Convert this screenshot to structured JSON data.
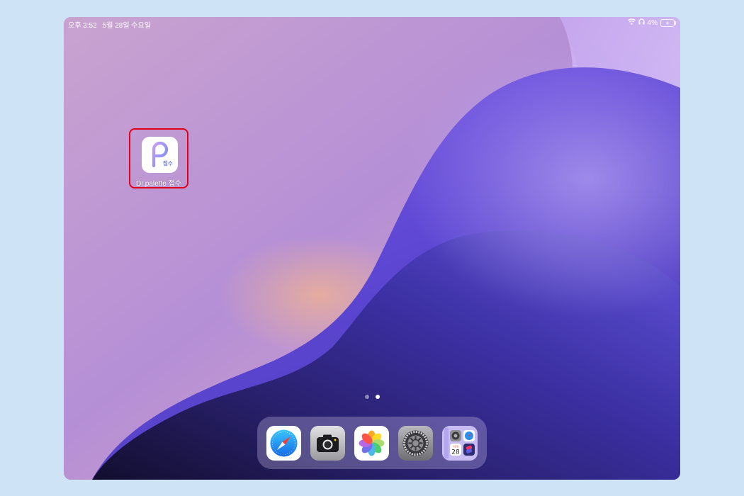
{
  "status_bar": {
    "time": "오후 3:52",
    "date": "5월 28일 수요일",
    "battery_percent": "4%"
  },
  "home_screen": {
    "apps": [
      {
        "label": "Dr.palette 접수",
        "icon_text": "접수",
        "icon": "dr-palette-icon",
        "highlighted": true
      }
    ],
    "page_count": 2,
    "active_page": 2
  },
  "dock": {
    "apps": [
      {
        "icon": "safari-icon"
      },
      {
        "icon": "camera-icon"
      },
      {
        "icon": "photos-icon"
      },
      {
        "icon": "settings-icon"
      },
      {
        "icon": "app-library-icon",
        "calendar_day": "28",
        "calendar_weekday": "수요일"
      }
    ]
  },
  "colors": {
    "highlight": "#e0001a",
    "page_background": "#cfe3f7",
    "app_accent": "#7a7ff0"
  }
}
